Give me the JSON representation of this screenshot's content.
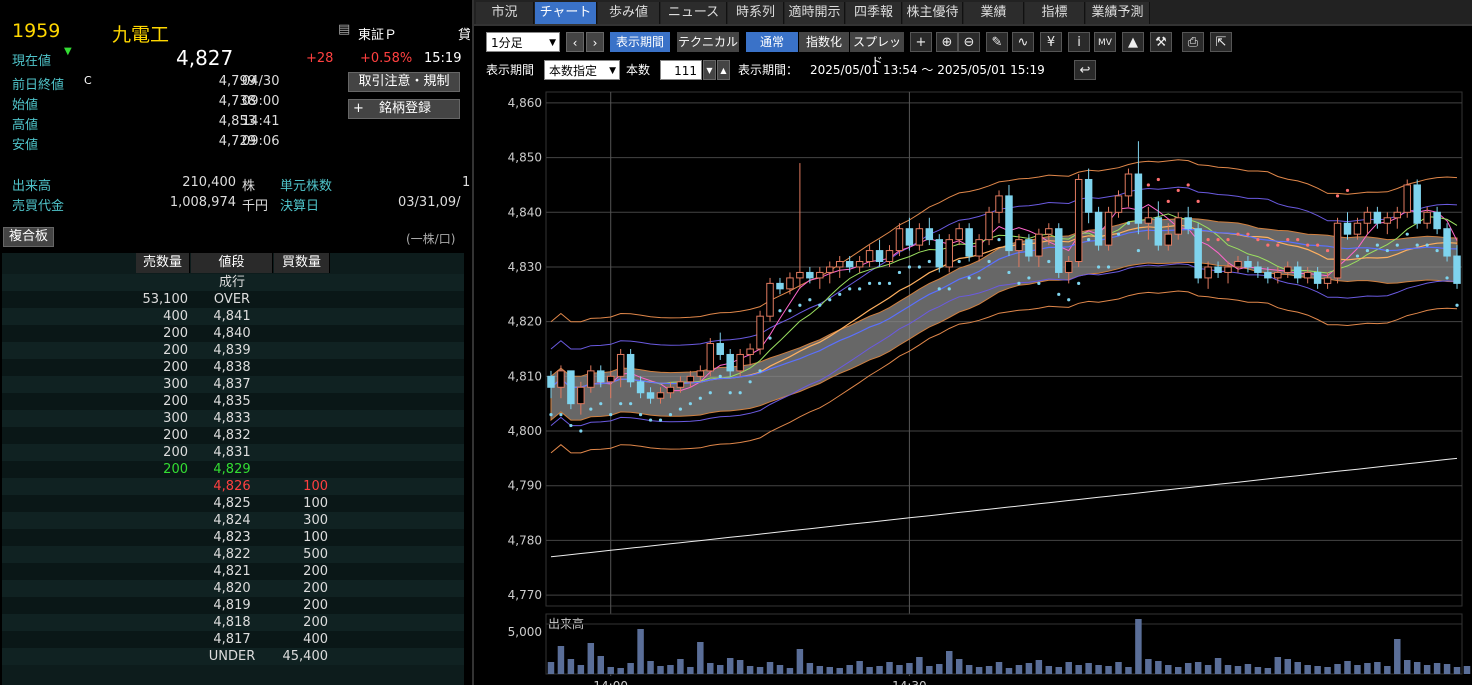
{
  "stock": {
    "code": "1959",
    "name": "九電工",
    "market": "東証Ｐ",
    "extra": "貸"
  },
  "quote": {
    "current_label": "現在値",
    "current_arrow": "▼",
    "current_price": "4,827",
    "change": "+28",
    "change_pct": "+0.58%",
    "time": "15:19",
    "prev_close_label": "前日終値",
    "prev_close_flag": "C",
    "prev_close": "4,799",
    "prev_close_date": "04/30",
    "open_label": "始値",
    "open": "4,738",
    "open_time": "09:00",
    "high_label": "高値",
    "high": "4,853",
    "high_time": "14:41",
    "low_label": "安値",
    "low": "4,729",
    "low_time": "09:06",
    "volume_label": "出来高",
    "volume": "210,400",
    "volume_unit": "株",
    "turnover_label": "売買代金",
    "turnover": "1,008,974",
    "turnover_unit": "千円",
    "unit_label": "単元株数",
    "unit_value": "1",
    "settle_label": "決算日",
    "settle_value": "03/31,09/"
  },
  "buttons": {
    "rules": "取引注意・規制",
    "register": "銘柄登録",
    "register_plus": "+",
    "composite_board": "複合板",
    "board_unit": "(一株/口)"
  },
  "board": {
    "headers": [
      "売数量",
      "値段",
      "買数量"
    ],
    "rows": [
      {
        "sell": "",
        "price": "成行",
        "buy": ""
      },
      {
        "sell": "53,100",
        "price": "OVER",
        "buy": ""
      },
      {
        "sell": "400",
        "price": "4,841",
        "buy": ""
      },
      {
        "sell": "200",
        "price": "4,840",
        "buy": ""
      },
      {
        "sell": "200",
        "price": "4,839",
        "buy": ""
      },
      {
        "sell": "200",
        "price": "4,838",
        "buy": ""
      },
      {
        "sell": "300",
        "price": "4,837",
        "buy": ""
      },
      {
        "sell": "200",
        "price": "4,835",
        "buy": ""
      },
      {
        "sell": "300",
        "price": "4,833",
        "buy": ""
      },
      {
        "sell": "200",
        "price": "4,832",
        "buy": ""
      },
      {
        "sell": "200",
        "price": "4,831",
        "buy": ""
      },
      {
        "sell": "200",
        "price": "4,829",
        "buy": "",
        "hl": "green"
      },
      {
        "sell": "",
        "price": "4,826",
        "buy": "100",
        "hl": "red"
      },
      {
        "sell": "",
        "price": "4,825",
        "buy": "100"
      },
      {
        "sell": "",
        "price": "4,824",
        "buy": "300"
      },
      {
        "sell": "",
        "price": "4,823",
        "buy": "100"
      },
      {
        "sell": "",
        "price": "4,822",
        "buy": "500"
      },
      {
        "sell": "",
        "price": "4,821",
        "buy": "200"
      },
      {
        "sell": "",
        "price": "4,820",
        "buy": "200"
      },
      {
        "sell": "",
        "price": "4,819",
        "buy": "200"
      },
      {
        "sell": "",
        "price": "4,818",
        "buy": "200"
      },
      {
        "sell": "",
        "price": "4,817",
        "buy": "400"
      },
      {
        "sell": "",
        "price": "UNDER",
        "buy": "45,400"
      }
    ]
  },
  "tabs": [
    "市況",
    "チャート",
    "歩み値",
    "ニュース",
    "時系列",
    "適時開示",
    "四季報",
    "株主優待",
    "業績",
    "指標",
    "業績予測"
  ],
  "active_tab": "チャート",
  "toolbar": {
    "interval": "1分足",
    "interval_arrow": "▼",
    "prev": "‹",
    "next": "›",
    "display_period": "表示期間",
    "technical": "テクニカル",
    "normal": "通常",
    "index": "指数化",
    "spread": "スプレッド",
    "icons": [
      "crosshair-icon",
      "zoom-in-icon",
      "zoom-out-icon",
      "pencil-icon",
      "line-chart-icon",
      "yen-icon",
      "info-icon",
      "volume-profile-icon",
      "area-chart-icon",
      "wrench-icon",
      "print-icon",
      "popout-icon"
    ],
    "icon_glyphs": [
      "+",
      "⊕",
      "⊖",
      "✎",
      "∿",
      "¥",
      "i",
      "MV",
      "▲",
      "⚒",
      "⎙",
      "⇱"
    ]
  },
  "toolbar2": {
    "period_label": "表示期間",
    "mode": "本数指定",
    "mode_arrow": "▼",
    "count_label": "本数",
    "count": "111",
    "range_label": "表示期間：",
    "range": "2025/05/01 13:54 〜 2025/05/01 15:19",
    "reset_icon": "↩"
  },
  "chart_data": {
    "type": "candlestick",
    "ylim": [
      4768,
      4862
    ],
    "yticks": [
      "4,860",
      "4,850",
      "4,840",
      "4,830",
      "4,820",
      "4,810",
      "4,800",
      "4,790",
      "4,780",
      "4,770"
    ],
    "xticks": [
      "14:00",
      "14:30"
    ],
    "volume_label": "出来高",
    "volume_tick": "5,000",
    "volume_max": 6000,
    "colors": {
      "up": "#000000",
      "up_edge": "#e07a5f",
      "down": "#7fd4ee",
      "grid": "#444444",
      "kumo": "#8a8a8a"
    },
    "candles": [
      [
        4810,
        4811,
        4806,
        4808
      ],
      [
        4808,
        4812,
        4806,
        4811
      ],
      [
        4811,
        4811,
        4804,
        4805
      ],
      [
        4805,
        4809,
        4803,
        4808
      ],
      [
        4808,
        4812,
        4807,
        4811
      ],
      [
        4811,
        4812,
        4808,
        4809
      ],
      [
        4809,
        4811,
        4806,
        4810
      ],
      [
        4810,
        4815,
        4808,
        4814
      ],
      [
        4814,
        4815,
        4808,
        4809
      ],
      [
        4809,
        4810,
        4806,
        4807
      ],
      [
        4807,
        4808,
        4805,
        4806
      ],
      [
        4806,
        4808,
        4805,
        4807
      ],
      [
        4807,
        4809,
        4806,
        4808
      ],
      [
        4808,
        4810,
        4807,
        4809
      ],
      [
        4809,
        4811,
        4808,
        4810
      ],
      [
        4810,
        4812,
        4809,
        4811
      ],
      [
        4811,
        4817,
        4810,
        4816
      ],
      [
        4816,
        4818,
        4813,
        4814
      ],
      [
        4814,
        4815,
        4810,
        4811
      ],
      [
        4811,
        4815,
        4810,
        4814
      ],
      [
        4814,
        4816,
        4812,
        4815
      ],
      [
        4815,
        4822,
        4814,
        4821
      ],
      [
        4821,
        4828,
        4820,
        4827
      ],
      [
        4827,
        4828,
        4825,
        4826
      ],
      [
        4826,
        4829,
        4825,
        4828
      ],
      [
        4828,
        4849,
        4826,
        4829
      ],
      [
        4829,
        4830,
        4827,
        4828
      ],
      [
        4828,
        4830,
        4826,
        4829
      ],
      [
        4829,
        4831,
        4827,
        4830
      ],
      [
        4830,
        4832,
        4828,
        4831
      ],
      [
        4831,
        4832,
        4829,
        4830
      ],
      [
        4830,
        4832,
        4829,
        4831
      ],
      [
        4831,
        4834,
        4830,
        4833
      ],
      [
        4833,
        4835,
        4830,
        4831
      ],
      [
        4831,
        4834,
        4830,
        4833
      ],
      [
        4833,
        4838,
        4832,
        4837
      ],
      [
        4837,
        4839,
        4833,
        4834
      ],
      [
        4834,
        4838,
        4833,
        4837
      ],
      [
        4837,
        4839,
        4834,
        4835
      ],
      [
        4835,
        4836,
        4829,
        4830
      ],
      [
        4830,
        4836,
        4829,
        4835
      ],
      [
        4835,
        4838,
        4834,
        4837
      ],
      [
        4837,
        4838,
        4831,
        4832
      ],
      [
        4832,
        4836,
        4831,
        4835
      ],
      [
        4835,
        4841,
        4834,
        4840
      ],
      [
        4840,
        4844,
        4838,
        4843
      ],
      [
        4843,
        4845,
        4832,
        4833
      ],
      [
        4833,
        4836,
        4830,
        4835
      ],
      [
        4835,
        4836,
        4831,
        4832
      ],
      [
        4832,
        4837,
        4830,
        4836
      ],
      [
        4836,
        4838,
        4834,
        4837
      ],
      [
        4837,
        4838,
        4828,
        4829
      ],
      [
        4829,
        4832,
        4827,
        4831
      ],
      [
        4831,
        4847,
        4830,
        4846
      ],
      [
        4846,
        4848,
        4838,
        4840
      ],
      [
        4840,
        4841,
        4833,
        4834
      ],
      [
        4834,
        4841,
        4833,
        4840
      ],
      [
        4840,
        4844,
        4839,
        4843
      ],
      [
        4843,
        4848,
        4841,
        4847
      ],
      [
        4847,
        4853,
        4836,
        4838
      ],
      [
        4838,
        4841,
        4835,
        4839
      ],
      [
        4839,
        4842,
        4833,
        4834
      ],
      [
        4834,
        4838,
        4833,
        4836
      ],
      [
        4836,
        4840,
        4835,
        4839
      ],
      [
        4839,
        4841,
        4836,
        4837
      ],
      [
        4837,
        4838,
        4827,
        4828
      ],
      [
        4828,
        4831,
        4826,
        4830
      ],
      [
        4830,
        4831,
        4828,
        4829
      ],
      [
        4829,
        4831,
        4827,
        4830
      ],
      [
        4830,
        4832,
        4829,
        4831
      ],
      [
        4831,
        4832,
        4829,
        4830
      ],
      [
        4830,
        4831,
        4828,
        4829
      ],
      [
        4829,
        4830,
        4827,
        4828
      ],
      [
        4828,
        4830,
        4827,
        4829
      ],
      [
        4829,
        4831,
        4828,
        4830
      ],
      [
        4830,
        4831,
        4827,
        4828
      ],
      [
        4828,
        4830,
        4827,
        4829
      ],
      [
        4829,
        4830,
        4826,
        4827
      ],
      [
        4827,
        4829,
        4826,
        4828
      ],
      [
        4828,
        4839,
        4827,
        4838
      ],
      [
        4838,
        4840,
        4835,
        4836
      ],
      [
        4836,
        4839,
        4835,
        4838
      ],
      [
        4838,
        4841,
        4836,
        4840
      ],
      [
        4840,
        4841,
        4837,
        4838
      ],
      [
        4838,
        4840,
        4836,
        4839
      ],
      [
        4839,
        4841,
        4837,
        4840
      ],
      [
        4840,
        4846,
        4839,
        4845
      ],
      [
        4845,
        4846,
        4837,
        4838
      ],
      [
        4838,
        4841,
        4837,
        4840
      ],
      [
        4840,
        4841,
        4836,
        4837
      ],
      [
        4837,
        4838,
        4831,
        4832
      ],
      [
        4832,
        4834,
        4826,
        4827
      ]
    ],
    "volumes": [
      1200,
      2800,
      1500,
      900,
      3100,
      1800,
      700,
      600,
      1100,
      4500,
      1300,
      800,
      900,
      1500,
      700,
      3200,
      1100,
      900,
      1600,
      1400,
      800,
      700,
      1200,
      900,
      600,
      2500,
      1100,
      800,
      700,
      600,
      900,
      1300,
      700,
      800,
      1200,
      900,
      1100,
      1700,
      800,
      1000,
      2300,
      1500,
      900,
      700,
      800,
      1200,
      600,
      900,
      1100,
      1400,
      800,
      700,
      1200,
      900,
      1100,
      900,
      800,
      1200,
      700,
      5500,
      1500,
      1300,
      900,
      700,
      1100,
      1200,
      900,
      1600,
      900,
      800,
      1000,
      700,
      600,
      1700,
      1500,
      1200,
      900,
      800,
      700,
      1000,
      1300,
      900,
      1100,
      1200,
      800,
      3500,
      1400,
      1200,
      900,
      1100,
      1000,
      700,
      800
    ]
  }
}
